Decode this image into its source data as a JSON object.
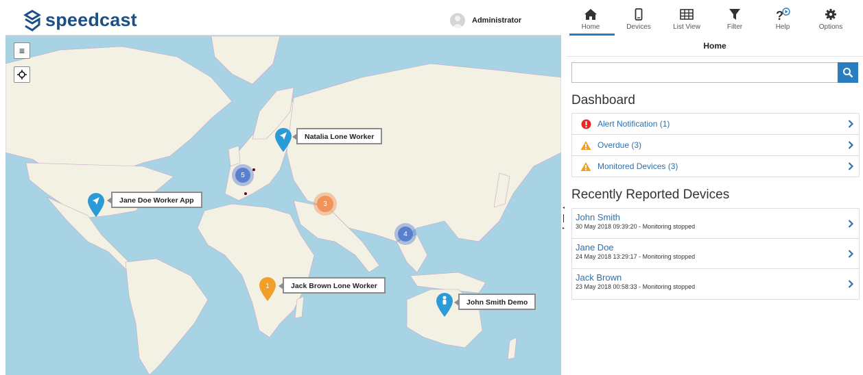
{
  "header": {
    "brand": "speedcast",
    "user": "Administrator"
  },
  "map": {
    "markers": [
      {
        "label": "Natalia Lone Worker",
        "color": "#2a9bd6",
        "icon": "navigation-arrow-icon"
      },
      {
        "label": "Jane Doe Worker App",
        "color": "#2a9bd6",
        "icon": "navigation-arrow-icon"
      },
      {
        "label": "Jack Brown Lone Worker",
        "color": "#f0a028",
        "icon": "alert-1-icon",
        "badge": "1"
      },
      {
        "label": "John Smith Demo",
        "color": "#2a9bd6",
        "icon": "person-icon"
      }
    ],
    "clusters": [
      {
        "count": "5",
        "color": "#5b7fcf"
      },
      {
        "count": "3",
        "color": "#f0935a"
      },
      {
        "count": "4",
        "color": "#5b7fcf"
      }
    ]
  },
  "nav": {
    "items": [
      {
        "label": "Home",
        "icon": "home-icon",
        "active": true
      },
      {
        "label": "Devices",
        "icon": "phone-icon"
      },
      {
        "label": "List View",
        "icon": "table-icon"
      },
      {
        "label": "Filter",
        "icon": "filter-icon"
      },
      {
        "label": "Help",
        "icon": "help-icon"
      },
      {
        "label": "Options",
        "icon": "gear-icon"
      }
    ]
  },
  "panel": {
    "title": "Home",
    "search": {
      "value": "",
      "placeholder": ""
    },
    "dashboard_title": "Dashboard",
    "dashboard": [
      {
        "label": "Alert Notification (1)",
        "icon": "alert-circle-icon",
        "color": "#e02b27"
      },
      {
        "label": "Overdue (3)",
        "icon": "warning-icon",
        "color": "#f0a028"
      },
      {
        "label": "Monitored Devices (3)",
        "icon": "warning-icon",
        "color": "#f0a028"
      }
    ],
    "recent_title": "Recently Reported Devices",
    "devices": [
      {
        "name": "John Smith",
        "status": "30 May 2018 09:39:20 - Monitoring stopped"
      },
      {
        "name": "Jane Doe",
        "status": "24 May 2018 13:29:17 - Monitoring stopped"
      },
      {
        "name": "Jack Brown",
        "status": "23 May 2018 00:58:33 - Monitoring stopped"
      }
    ]
  },
  "colors": {
    "accent": "#2a7ec0",
    "link": "#2a6fb0",
    "brand": "#1b4f86",
    "water": "#a8d3e4",
    "land": "#f3f0e4"
  }
}
